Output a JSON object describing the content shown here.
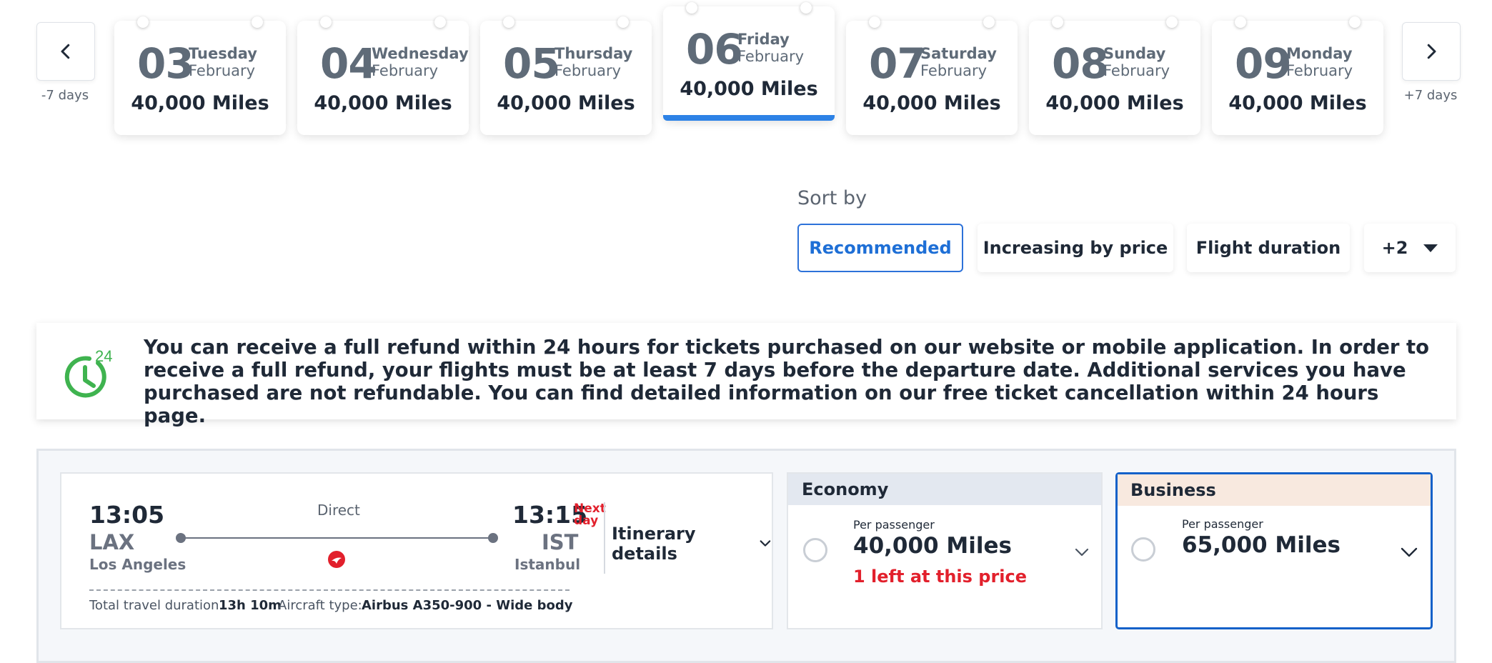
{
  "date_nav": {
    "prev_caption": "-7 days",
    "next_caption": "+7 days",
    "days": [
      {
        "day": "03",
        "weekday": "Tuesday",
        "month": "February",
        "price": "40,000 Miles",
        "selected": false
      },
      {
        "day": "04",
        "weekday": "Wednesday",
        "month": "February",
        "price": "40,000 Miles",
        "selected": false
      },
      {
        "day": "05",
        "weekday": "Thursday",
        "month": "February",
        "price": "40,000 Miles",
        "selected": false
      },
      {
        "day": "06",
        "weekday": "Friday",
        "month": "February",
        "price": "40,000 Miles",
        "selected": true
      },
      {
        "day": "07",
        "weekday": "Saturday",
        "month": "February",
        "price": "40,000 Miles",
        "selected": false
      },
      {
        "day": "08",
        "weekday": "Sunday",
        "month": "February",
        "price": "40,000 Miles",
        "selected": false
      },
      {
        "day": "09",
        "weekday": "Monday",
        "month": "February",
        "price": "40,000 Miles",
        "selected": false
      }
    ]
  },
  "sort": {
    "label": "Sort by",
    "options": [
      "Recommended",
      "Increasing by price",
      "Flight duration"
    ],
    "more_label": "+2",
    "active": "Recommended"
  },
  "refund_notice": {
    "badge": "24",
    "text": "You can receive a full refund within 24 hours for tickets purchased on our website or mobile application. In order to receive a full refund, your flights must be at least 7 days before the departure date. Additional services you have purchased are not refundable. You can find detailed information on our free ticket cancellation within 24 hours page."
  },
  "flight": {
    "departure": {
      "time": "13:05",
      "code": "LAX",
      "city": "Los Angeles"
    },
    "arrival": {
      "time": "13:15",
      "code": "IST",
      "city": "Istanbul",
      "next_day": "Next day"
    },
    "stops": "Direct",
    "duration_label": "Total travel duration",
    "duration": "13h 10m",
    "aircraft_label": "Aircraft type:",
    "aircraft": "Airbus A350-900 - Wide body",
    "itinerary_label": "Itinerary details"
  },
  "fares": {
    "economy": {
      "label": "Economy",
      "per": "Per passenger",
      "price": "40,000 Miles",
      "availability": "1 left at this price",
      "header_color": "#e3e8f0"
    },
    "business": {
      "label": "Business",
      "per": "Per passenger",
      "price": "65,000 Miles",
      "header_color": "#f8e9df"
    }
  },
  "colors": {
    "accent_blue": "#2d82e6",
    "selected_border": "#1461c9",
    "alert_red": "#e2202c",
    "refund_green": "#3fb34f"
  }
}
